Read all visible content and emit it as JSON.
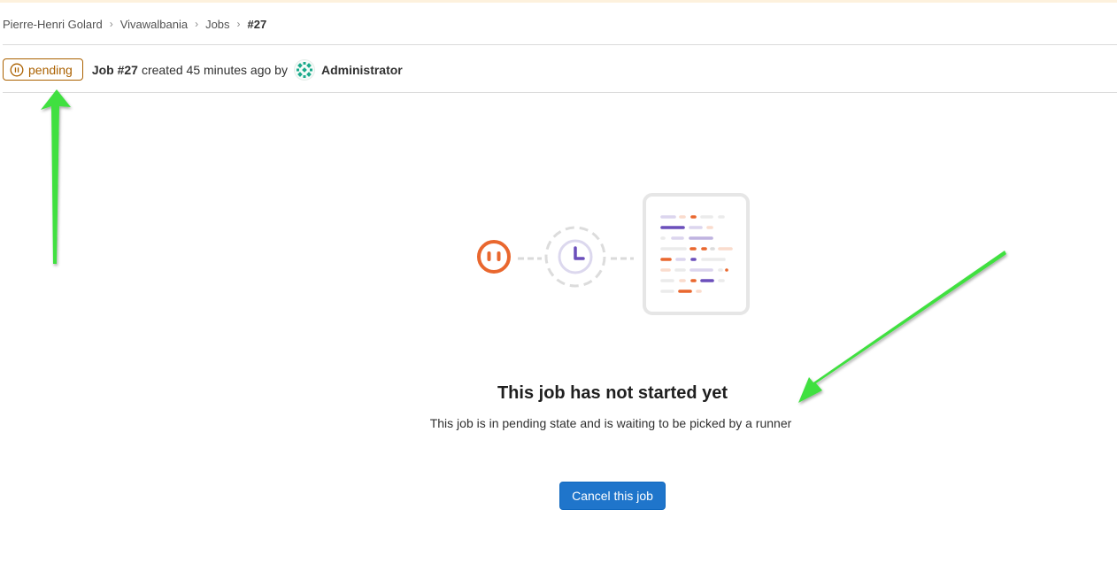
{
  "breadcrumb": {
    "items": [
      {
        "label": "Pierre-Henri Golard"
      },
      {
        "label": "Vivawalbania"
      },
      {
        "label": "Jobs"
      },
      {
        "label": "#27"
      }
    ],
    "separator": "›"
  },
  "job": {
    "status": "pending",
    "status_color": "#ab6100",
    "title": "Job #27",
    "meta": "created 45 minutes ago by",
    "author": "Administrator"
  },
  "empty_state": {
    "title": "This job has not started yet",
    "description": "This job is in pending state and is waiting to be picked by a runner"
  },
  "actions": {
    "cancel_label": "Cancel this job"
  },
  "colors": {
    "accent": "#1f75cb",
    "annotation_arrow": "#3fe03f",
    "illustration_orange": "#e9672e",
    "illustration_purple": "#6b4fbb"
  },
  "icons": {
    "status": "pause-circle-icon",
    "avatar": "identicon-avatar",
    "pending": "pause-icon",
    "waiting": "clock-icon",
    "log": "job-log-icon"
  }
}
